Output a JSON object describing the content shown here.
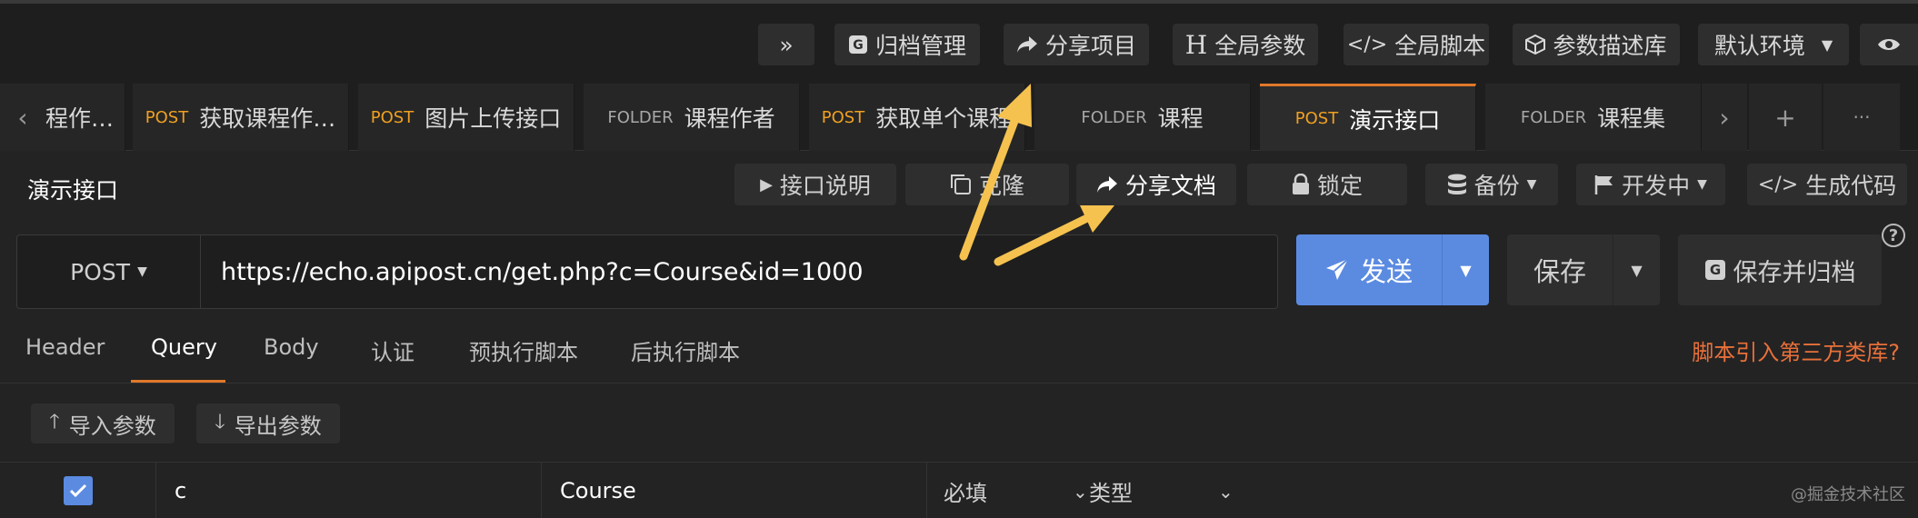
{
  "topbar": {
    "collapse_label": "»",
    "archive_label": "归档管理",
    "share_project_label": "分享项目",
    "global_params_label": "全局参数",
    "global_script_label": "全局脚本",
    "param_lib_label": "参数描述库",
    "env_label": "默认环境"
  },
  "tabs": [
    {
      "method": "",
      "name": "程作…"
    },
    {
      "method": "POST",
      "name": "获取课程作…"
    },
    {
      "method": "POST",
      "name": "图片上传接口"
    },
    {
      "method": "FOLDER",
      "name": "课程作者"
    },
    {
      "method": "POST",
      "name": "获取单个课程"
    },
    {
      "method": "FOLDER",
      "name": "课程"
    },
    {
      "method": "POST",
      "name": "演示接口"
    },
    {
      "method": "FOLDER",
      "name": "课程集"
    }
  ],
  "tab_controls": {
    "next": "›",
    "prev": "‹",
    "add": "+",
    "more": "···"
  },
  "toolbar": {
    "request_name": "演示接口",
    "desc_label": "接口说明",
    "clone_label": "克隆",
    "share_doc_label": "分享文档",
    "lock_label": "锁定",
    "backup_label": "备份",
    "status_label": "开发中",
    "gen_code_label": "生成代码"
  },
  "request": {
    "method": "POST",
    "url": "https://echo.apipost.cn/get.php?c=Course&id=1000",
    "send_label": "发送",
    "save_label": "保存",
    "save_archive_label": "保存并归档",
    "help": "?"
  },
  "subtabs": [
    "Header",
    "Query",
    "Body",
    "认证",
    "预执行脚本",
    "后执行脚本"
  ],
  "script_link": "脚本引入第三方类库?",
  "param_actions": {
    "import_label": "导入参数",
    "export_label": "导出参数"
  },
  "param_row": {
    "key": "c",
    "value": "Course",
    "required": "必填",
    "type": "类型"
  },
  "watermark": "@掘金技术社区",
  "colors": {
    "accent": "#5b8be1",
    "orange": "#e0782a",
    "method_post": "#f0a020",
    "annotation_arrow": "#f5c24f"
  }
}
